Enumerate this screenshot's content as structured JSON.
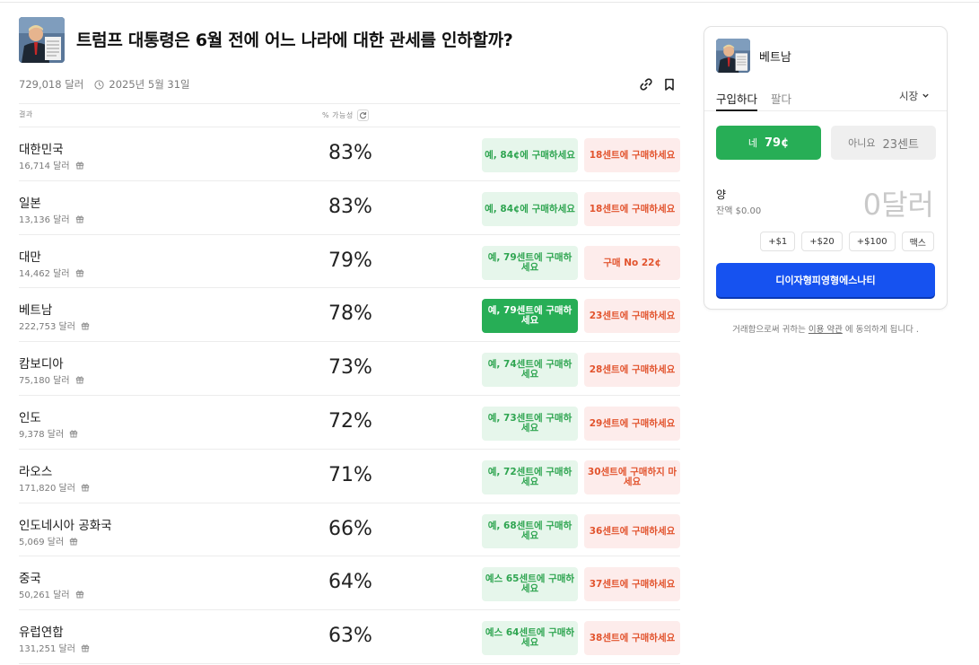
{
  "event": {
    "title": "트럼프 대통령은 6월 전에 어느 나라에 대한 관세를 인하할까?",
    "volume": "729,018 달러",
    "end_date": "2025년 5월 31일",
    "icons": [
      "link-icon",
      "bookmark-icon",
      "clock-icon"
    ]
  },
  "columns": {
    "outcome": "결과",
    "probability": "% 가능성"
  },
  "outcomes": [
    {
      "name": "대한민국",
      "volume": "16,714 달러",
      "probability": "83%",
      "yes_label": "예, 84¢에 구매하세요",
      "no_label": "18센트에 구매하세요"
    },
    {
      "name": "일본",
      "volume": "13,136 달러",
      "probability": "83%",
      "yes_label": "예, 84¢에 구매하세요",
      "no_label": "18센트에 구매하세요"
    },
    {
      "name": "대만",
      "volume": "14,462 달러",
      "probability": "79%",
      "yes_label": "예, 79센트에 구매하세요",
      "no_label": "구매 No 22¢"
    },
    {
      "name": "베트남",
      "volume": "222,753 달러",
      "probability": "78%",
      "yes_label": "예, 79센트에 구매하세요",
      "no_label": "23센트에 구매하세요"
    },
    {
      "name": "캄보디아",
      "volume": "75,180 달러",
      "probability": "73%",
      "yes_label": "예, 74센트에 구매하세요",
      "no_label": "28센트에 구매하세요"
    },
    {
      "name": "인도",
      "volume": "9,378 달러",
      "probability": "72%",
      "yes_label": "예, 73센트에 구매하세요",
      "no_label": "29센트에 구매하세요"
    },
    {
      "name": "라오스",
      "volume": "171,820 달러",
      "probability": "71%",
      "yes_label": "예, 72센트에 구매하세요",
      "no_label": "30센트에 구매하지 마세요"
    },
    {
      "name": "인도네시아 공화국",
      "volume": "5,069 달러",
      "probability": "66%",
      "yes_label": "예, 68센트에 구매하세요",
      "no_label": "36센트에 구매하세요"
    },
    {
      "name": "중국",
      "volume": "50,261 달러",
      "probability": "64%",
      "yes_label": "예스 65센트에 구매하세요",
      "no_label": "37센트에 구매하세요"
    },
    {
      "name": "유럽연합",
      "volume": "131,251 달러",
      "probability": "63%",
      "yes_label": "예스 64센트에 구매하세요",
      "no_label": "38센트에 구매하세요"
    }
  ],
  "selected_outcome_index": 3,
  "trade_panel": {
    "market_name": "베트남",
    "tab_buy": "구입하다",
    "tab_sell": "팔다",
    "order_type": "시장",
    "yes_label": "네",
    "yes_price": "79¢",
    "no_label": "아니요",
    "no_price": "23센트",
    "amount_label": "양",
    "balance": "잔액 $0.00",
    "amount_value": "0달러",
    "quick_amounts": [
      "+$1",
      "+$20",
      "+$100",
      "맥스"
    ],
    "submit_label": "디이자형피영형에스나티"
  },
  "terms": {
    "prefix": "거래함으로써 귀하는",
    "link": "이용 약관",
    "suffix": "에 동의하게 됩니다 ."
  },
  "colors": {
    "yes_green": "#27ae56",
    "yes_bg": "#e6f6eb",
    "no_orange": "#e2542e",
    "no_bg": "#fdeceb",
    "primary_blue": "#1652f0"
  }
}
